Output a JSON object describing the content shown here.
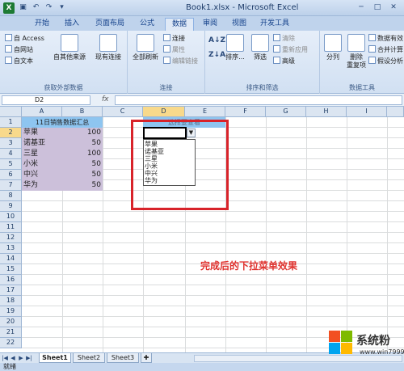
{
  "window": {
    "title": "Book1.xlsx - Microsoft Excel",
    "app_icon": "X"
  },
  "quick_access": [
    "save-icon",
    "undo-icon",
    "redo-icon",
    "customize-icon"
  ],
  "tabs": [
    {
      "label": "开始"
    },
    {
      "label": "插入"
    },
    {
      "label": "页面布局"
    },
    {
      "label": "公式"
    },
    {
      "label": "数据",
      "active": true
    },
    {
      "label": "审阅"
    },
    {
      "label": "视图"
    },
    {
      "label": "开发工具"
    }
  ],
  "ribbon": {
    "external": {
      "title": "获取外部数据",
      "access": "自 Access",
      "web": "自网站",
      "text": "自文本",
      "other": "自其他来源",
      "existing": "现有连接"
    },
    "connections": {
      "title": "连接",
      "refresh": "全部刷新",
      "connect": "连接",
      "props": "属性",
      "edit_links": "编辑链接"
    },
    "sortfilter": {
      "title": "排序和筛选",
      "sort": "排序...",
      "filter": "筛选",
      "clear": "清除",
      "reapply": "重新应用",
      "advanced": "高级"
    },
    "tools": {
      "title": "数据工具",
      "split": "分列",
      "remove_dup_1": "删除",
      "remove_dup_2": "重复项",
      "validate": "数据有效",
      "consolidate": "合并计算",
      "whatif": "假设分析"
    }
  },
  "formula_bar": {
    "name_box": "D2",
    "fx": "fx",
    "value": ""
  },
  "columns": [
    "A",
    "B",
    "C",
    "D",
    "E",
    "F",
    "G",
    "H",
    "I"
  ],
  "rows": [
    "1",
    "2",
    "3",
    "4",
    "5",
    "6",
    "7",
    "8",
    "9",
    "10",
    "11",
    "12",
    "13",
    "14",
    "15",
    "16",
    "17",
    "18",
    "19",
    "20",
    "21",
    "22"
  ],
  "table": {
    "header": "11日销售数据汇总",
    "data": [
      {
        "name": "苹果",
        "value": "100"
      },
      {
        "name": "诺基亚",
        "value": "50"
      },
      {
        "name": "三星",
        "value": "100"
      },
      {
        "name": "小米",
        "value": "50"
      },
      {
        "name": "中兴",
        "value": "50"
      },
      {
        "name": "华为",
        "value": "50"
      }
    ]
  },
  "d1_header": "选择要查看",
  "dropdown_options": [
    "苹果",
    "诺基亚",
    "三星",
    "小米",
    "中兴",
    "华为"
  ],
  "annotation": "完成后的下拉菜单效果",
  "sheets": [
    "Sheet1",
    "Sheet2",
    "Sheet3"
  ],
  "status": "就绪",
  "watermark": {
    "text": "系统粉",
    "url": "www.win7999.com"
  },
  "colors": {
    "accent": "#d8232a",
    "header_fill": "#8ec5f0",
    "data_fill": "#ccc0da"
  }
}
